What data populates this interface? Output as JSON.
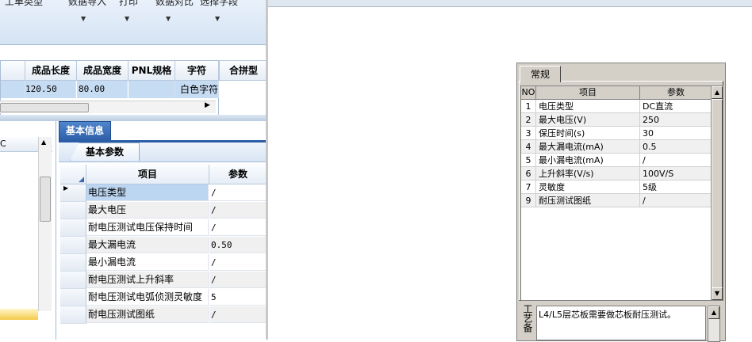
{
  "toolbar": {
    "items": [
      {
        "label": "工单类型"
      },
      {
        "label": "数据导入"
      },
      {
        "label": "打印"
      },
      {
        "label": "数据对比"
      },
      {
        "label": "选择字段"
      }
    ]
  },
  "grid1": {
    "columns": [
      "成品长度",
      "成品宽度",
      "PNL规格",
      "字符"
    ],
    "row": [
      "120.50",
      "80.00",
      "",
      "白色字符"
    ],
    "merge_header": "合拼型"
  },
  "left_panel": {
    "header": "C"
  },
  "info_panel": {
    "tab": "基本信息",
    "subtab": "基本参数",
    "columns": [
      "项目",
      "参数"
    ],
    "rows": [
      {
        "item": "电压类型",
        "value": "/"
      },
      {
        "item": "最大电压",
        "value": "/"
      },
      {
        "item": "耐电压测试电压保持时间",
        "value": "/"
      },
      {
        "item": "最大漏电流",
        "value": "0.50"
      },
      {
        "item": "最小漏电流",
        "value": "/"
      },
      {
        "item": "耐电压测试上升斜率",
        "value": "/"
      },
      {
        "item": "耐电压测试电弧侦测灵敏度",
        "value": "5"
      },
      {
        "item": "耐电压测试图纸",
        "value": "/"
      }
    ]
  },
  "dialog": {
    "tab": "常规",
    "columns": [
      "NO",
      "项目",
      "参数"
    ],
    "rows": [
      {
        "no": "1",
        "item": "电压类型",
        "value": "DC直流"
      },
      {
        "no": "2",
        "item": "最大电压(V)",
        "value": "250"
      },
      {
        "no": "3",
        "item": "保压时间(s)",
        "value": "30"
      },
      {
        "no": "4",
        "item": "最大漏电流(mA)",
        "value": "0.5"
      },
      {
        "no": "5",
        "item": "最小漏电流(mA)",
        "value": "/"
      },
      {
        "no": "6",
        "item": "上升斜率(V/s)",
        "value": "100V/S"
      },
      {
        "no": "7",
        "item": "灵敏度",
        "value": "5级"
      },
      {
        "no": "9",
        "item": "耐压测试图纸",
        "value": "/"
      }
    ],
    "memo_label": "工艺备",
    "memo_text": "L4/L5层芯板需要做芯板耐压测试。"
  }
}
